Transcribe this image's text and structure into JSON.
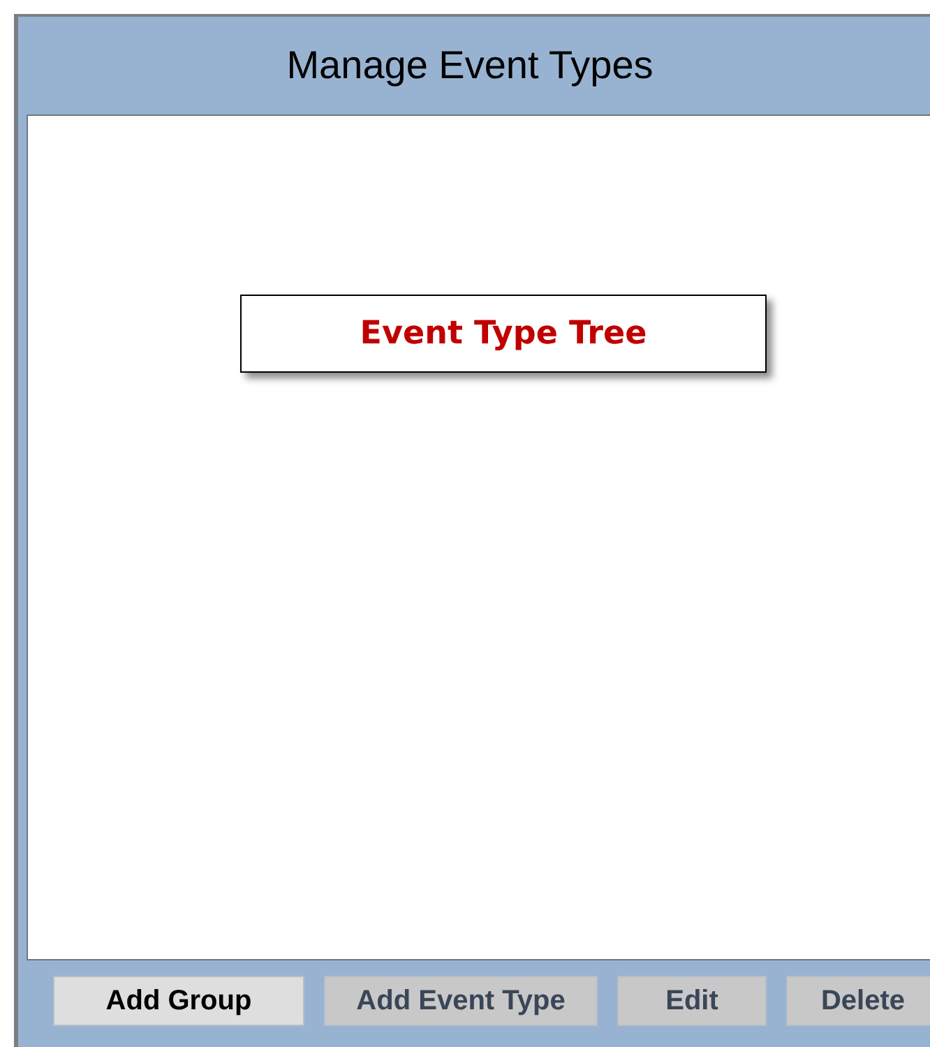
{
  "window": {
    "title": "Manage Event Types"
  },
  "tree_area": {
    "label": "Event Type Tree"
  },
  "buttons": [
    {
      "label": "Add Group",
      "disabled": false
    },
    {
      "label": "Add Event Type",
      "disabled": true
    },
    {
      "label": "Edit",
      "disabled": true
    },
    {
      "label": "Delete",
      "disabled": true
    }
  ]
}
